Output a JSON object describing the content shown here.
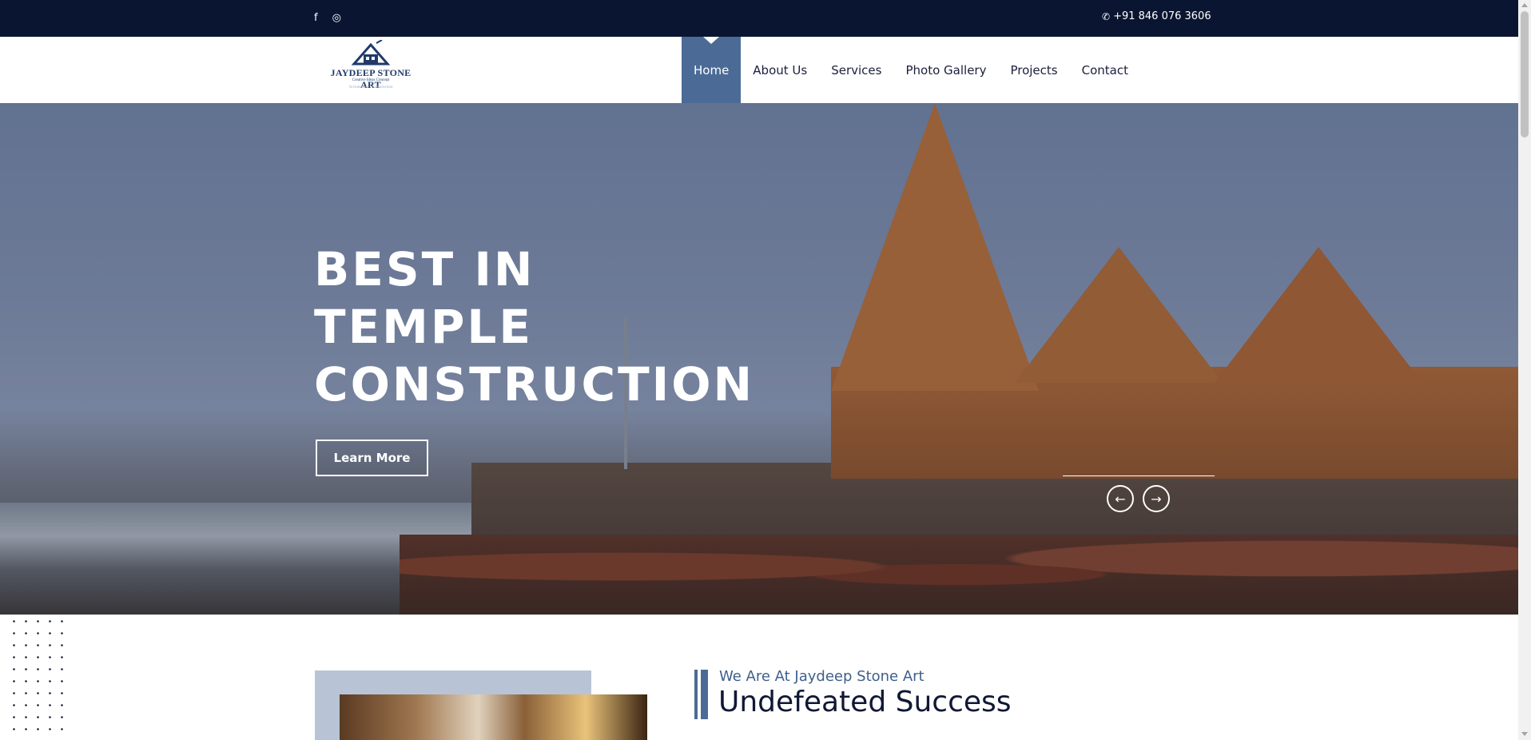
{
  "topbar": {
    "social": [
      {
        "icon": "facebook-icon",
        "glyph": "f"
      },
      {
        "icon": "instagram-icon",
        "glyph": "◎"
      }
    ],
    "phone_icon": "phone-icon",
    "phone": "+91 846 076 3606"
  },
  "logo": {
    "text": "JAYDEEP STONE ART",
    "tagline": "Creative Ideas Concept",
    "tagline2": "Architecture · Construction"
  },
  "nav": {
    "items": [
      {
        "label": "Home",
        "active": true
      },
      {
        "label": "About Us",
        "active": false
      },
      {
        "label": "Services",
        "active": false
      },
      {
        "label": "Photo Gallery",
        "active": false
      },
      {
        "label": "Projects",
        "active": false
      },
      {
        "label": "Contact",
        "active": false
      }
    ]
  },
  "hero": {
    "title_lines": [
      "BEST IN",
      "TEMPLE",
      "CONSTRUCTION"
    ],
    "cta": "Learn More",
    "prev_glyph": "←",
    "next_glyph": "→"
  },
  "about": {
    "kicker": "We Are At Jaydeep Stone Art",
    "title": "Undefeated Success"
  },
  "colors": {
    "topbar_bg": "#0a1631",
    "accent": "#4b6b96",
    "heading": "#0f1835"
  }
}
